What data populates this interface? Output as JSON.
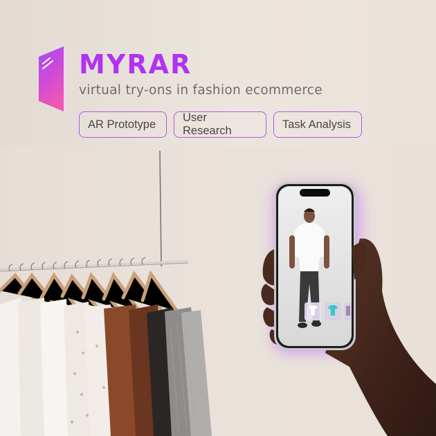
{
  "brand": {
    "title": "MYRAR",
    "subtitle": "virtual try-ons in fashion ecommerce"
  },
  "tags": [
    "AR Prototype",
    "User Research",
    "Task Analysis"
  ],
  "colors": {
    "brand": "#b033f0",
    "tag_border": "#b457e8",
    "background": "#ebe4dd",
    "phone_glow": "#c069ff"
  },
  "icons": {
    "logo": "mirror-logo-icon",
    "phone_thumbnails": [
      "white-tshirt-icon",
      "teal-tshirt-icon",
      "garment-icon"
    ]
  }
}
